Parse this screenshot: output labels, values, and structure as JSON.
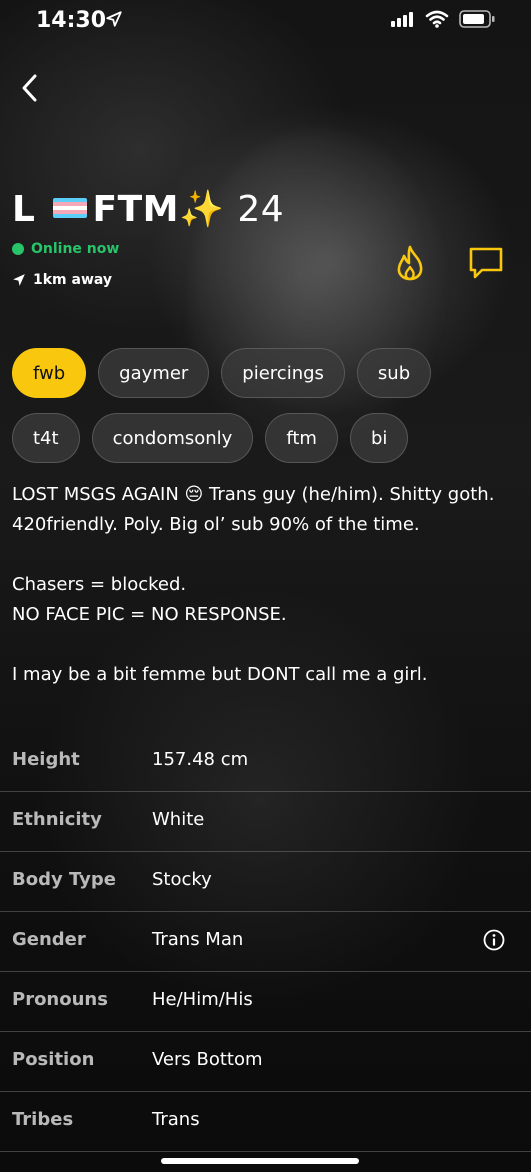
{
  "status_bar": {
    "time": "14:30"
  },
  "profile": {
    "name": "L",
    "flag": "transgender-flag",
    "name_suffix": "FTM",
    "sparkle": "✨",
    "age": "24",
    "online_status": "Online now",
    "distance": "1km away"
  },
  "colors": {
    "accent": "#f9c80e",
    "online": "#27c46a",
    "label": "#b9b9b9"
  },
  "tags_row1": [
    {
      "label": "fwb",
      "active": true
    },
    {
      "label": "gaymer",
      "active": false
    },
    {
      "label": "piercings",
      "active": false
    },
    {
      "label": "sub",
      "active": false
    }
  ],
  "tags_row2": [
    {
      "label": "t4t",
      "active": false
    },
    {
      "label": "condomsonly",
      "active": false
    },
    {
      "label": "ftm",
      "active": false
    },
    {
      "label": "bi",
      "active": false
    }
  ],
  "bio": {
    "line1": "LOST MSGS AGAIN 😔 Trans guy (he/him). Shitty goth. 420friendly. Poly. Big ol’ sub 90% of the time.",
    "line2": "Chasers = blocked.",
    "line3": "NO FACE PIC = NO RESPONSE.",
    "line4": "I may be a bit femme but DONT call me a girl."
  },
  "details": [
    {
      "label": "Height",
      "value": "157.48 cm"
    },
    {
      "label": "Ethnicity",
      "value": "White"
    },
    {
      "label": "Body Type",
      "value": "Stocky"
    },
    {
      "label": "Gender",
      "value": "Trans Man"
    },
    {
      "label": "Pronouns",
      "value": "He/Him/His"
    },
    {
      "label": "Position",
      "value": "Vers Bottom"
    },
    {
      "label": "Tribes",
      "value": "Trans"
    }
  ]
}
